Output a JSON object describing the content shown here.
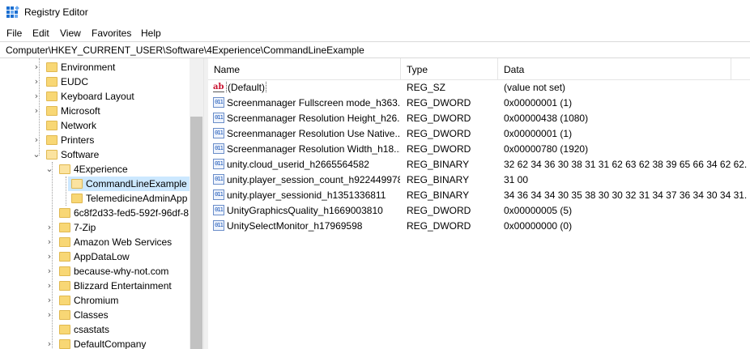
{
  "window": {
    "title": "Registry Editor"
  },
  "menu": [
    "File",
    "Edit",
    "View",
    "Favorites",
    "Help"
  ],
  "address": "Computer\\HKEY_CURRENT_USER\\Software\\4Experience\\CommandLineExample",
  "tree": [
    {
      "label": "Environment",
      "chevron": "›"
    },
    {
      "label": "EUDC",
      "chevron": "›"
    },
    {
      "label": "Keyboard Layout",
      "chevron": "›"
    },
    {
      "label": "Microsoft",
      "chevron": "›"
    },
    {
      "label": "Network",
      "chevron": ""
    },
    {
      "label": "Printers",
      "chevron": "›"
    },
    {
      "label": "Software",
      "chevron": "⌄"
    },
    {
      "label": "4Experience",
      "chevron": "⌄"
    },
    {
      "label": "CommandLineExample",
      "chevron": ""
    },
    {
      "label": "TelemedicineAdminApp",
      "chevron": ""
    },
    {
      "label": "6c8f2d33-fed5-592f-96df-8",
      "chevron": ""
    },
    {
      "label": "7-Zip",
      "chevron": "›"
    },
    {
      "label": "Amazon Web Services",
      "chevron": "›"
    },
    {
      "label": "AppDataLow",
      "chevron": "›"
    },
    {
      "label": "because-why-not.com",
      "chevron": "›"
    },
    {
      "label": "Blizzard Entertainment",
      "chevron": "›"
    },
    {
      "label": "Chromium",
      "chevron": "›"
    },
    {
      "label": "Classes",
      "chevron": "›"
    },
    {
      "label": "csastats",
      "chevron": ""
    },
    {
      "label": "DefaultCompany",
      "chevron": "›"
    }
  ],
  "columns": {
    "name": "Name",
    "type": "Type",
    "data": "Data"
  },
  "values": [
    {
      "name": "(Default)",
      "type": "REG_SZ",
      "data": "(value not set)",
      "icon": "sz"
    },
    {
      "name": "Screenmanager Fullscreen mode_h363...",
      "type": "REG_DWORD",
      "data": "0x00000001 (1)",
      "icon": "bin"
    },
    {
      "name": "Screenmanager Resolution Height_h26...",
      "type": "REG_DWORD",
      "data": "0x00000438 (1080)",
      "icon": "bin"
    },
    {
      "name": "Screenmanager Resolution Use Native...",
      "type": "REG_DWORD",
      "data": "0x00000001 (1)",
      "icon": "bin"
    },
    {
      "name": "Screenmanager Resolution Width_h18...",
      "type": "REG_DWORD",
      "data": "0x00000780 (1920)",
      "icon": "bin"
    },
    {
      "name": "unity.cloud_userid_h2665564582",
      "type": "REG_BINARY",
      "data": "32 62 34 36 30 38 31 31 62 63 62 38 39 65 66 34 62 62...",
      "icon": "bin"
    },
    {
      "name": "unity.player_session_count_h922449978",
      "type": "REG_BINARY",
      "data": "31 00",
      "icon": "bin"
    },
    {
      "name": "unity.player_sessionid_h1351336811",
      "type": "REG_BINARY",
      "data": "34 36 34 34 30 35 38 30 30 32 31 34 37 36 34 30 34 31...",
      "icon": "bin"
    },
    {
      "name": "UnityGraphicsQuality_h1669003810",
      "type": "REG_DWORD",
      "data": "0x00000005 (5)",
      "icon": "bin"
    },
    {
      "name": "UnitySelectMonitor_h17969598",
      "type": "REG_DWORD",
      "data": "0x00000000 (0)",
      "icon": "bin"
    }
  ],
  "icons": {
    "app": "registry-editor-icon",
    "folder": "folder-icon",
    "string_value": "string-value-icon",
    "binary_value": "binary-value-icon"
  },
  "colors": {
    "selection": "#cce8ff",
    "folder": "#f8d775",
    "accent": "#1c6fd1"
  }
}
